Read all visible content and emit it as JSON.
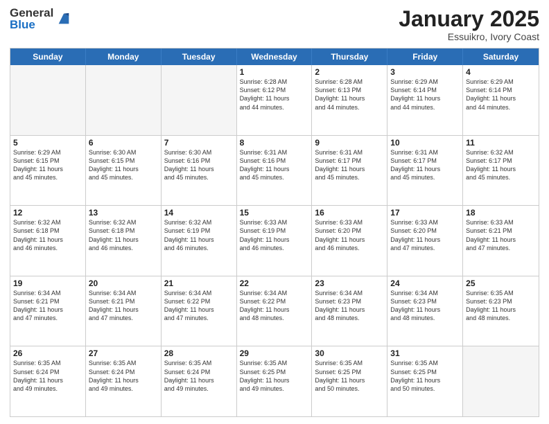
{
  "logo": {
    "general": "General",
    "blue": "Blue"
  },
  "header": {
    "month": "January 2025",
    "location": "Essuikro, Ivory Coast"
  },
  "days_of_week": [
    "Sunday",
    "Monday",
    "Tuesday",
    "Wednesday",
    "Thursday",
    "Friday",
    "Saturday"
  ],
  "weeks": [
    [
      {
        "day": "",
        "info": ""
      },
      {
        "day": "",
        "info": ""
      },
      {
        "day": "",
        "info": ""
      },
      {
        "day": "1",
        "info": "Sunrise: 6:28 AM\nSunset: 6:12 PM\nDaylight: 11 hours\nand 44 minutes."
      },
      {
        "day": "2",
        "info": "Sunrise: 6:28 AM\nSunset: 6:13 PM\nDaylight: 11 hours\nand 44 minutes."
      },
      {
        "day": "3",
        "info": "Sunrise: 6:29 AM\nSunset: 6:14 PM\nDaylight: 11 hours\nand 44 minutes."
      },
      {
        "day": "4",
        "info": "Sunrise: 6:29 AM\nSunset: 6:14 PM\nDaylight: 11 hours\nand 44 minutes."
      }
    ],
    [
      {
        "day": "5",
        "info": "Sunrise: 6:29 AM\nSunset: 6:15 PM\nDaylight: 11 hours\nand 45 minutes."
      },
      {
        "day": "6",
        "info": "Sunrise: 6:30 AM\nSunset: 6:15 PM\nDaylight: 11 hours\nand 45 minutes."
      },
      {
        "day": "7",
        "info": "Sunrise: 6:30 AM\nSunset: 6:16 PM\nDaylight: 11 hours\nand 45 minutes."
      },
      {
        "day": "8",
        "info": "Sunrise: 6:31 AM\nSunset: 6:16 PM\nDaylight: 11 hours\nand 45 minutes."
      },
      {
        "day": "9",
        "info": "Sunrise: 6:31 AM\nSunset: 6:17 PM\nDaylight: 11 hours\nand 45 minutes."
      },
      {
        "day": "10",
        "info": "Sunrise: 6:31 AM\nSunset: 6:17 PM\nDaylight: 11 hours\nand 45 minutes."
      },
      {
        "day": "11",
        "info": "Sunrise: 6:32 AM\nSunset: 6:17 PM\nDaylight: 11 hours\nand 45 minutes."
      }
    ],
    [
      {
        "day": "12",
        "info": "Sunrise: 6:32 AM\nSunset: 6:18 PM\nDaylight: 11 hours\nand 46 minutes."
      },
      {
        "day": "13",
        "info": "Sunrise: 6:32 AM\nSunset: 6:18 PM\nDaylight: 11 hours\nand 46 minutes."
      },
      {
        "day": "14",
        "info": "Sunrise: 6:32 AM\nSunset: 6:19 PM\nDaylight: 11 hours\nand 46 minutes."
      },
      {
        "day": "15",
        "info": "Sunrise: 6:33 AM\nSunset: 6:19 PM\nDaylight: 11 hours\nand 46 minutes."
      },
      {
        "day": "16",
        "info": "Sunrise: 6:33 AM\nSunset: 6:20 PM\nDaylight: 11 hours\nand 46 minutes."
      },
      {
        "day": "17",
        "info": "Sunrise: 6:33 AM\nSunset: 6:20 PM\nDaylight: 11 hours\nand 47 minutes."
      },
      {
        "day": "18",
        "info": "Sunrise: 6:33 AM\nSunset: 6:21 PM\nDaylight: 11 hours\nand 47 minutes."
      }
    ],
    [
      {
        "day": "19",
        "info": "Sunrise: 6:34 AM\nSunset: 6:21 PM\nDaylight: 11 hours\nand 47 minutes."
      },
      {
        "day": "20",
        "info": "Sunrise: 6:34 AM\nSunset: 6:21 PM\nDaylight: 11 hours\nand 47 minutes."
      },
      {
        "day": "21",
        "info": "Sunrise: 6:34 AM\nSunset: 6:22 PM\nDaylight: 11 hours\nand 47 minutes."
      },
      {
        "day": "22",
        "info": "Sunrise: 6:34 AM\nSunset: 6:22 PM\nDaylight: 11 hours\nand 48 minutes."
      },
      {
        "day": "23",
        "info": "Sunrise: 6:34 AM\nSunset: 6:23 PM\nDaylight: 11 hours\nand 48 minutes."
      },
      {
        "day": "24",
        "info": "Sunrise: 6:34 AM\nSunset: 6:23 PM\nDaylight: 11 hours\nand 48 minutes."
      },
      {
        "day": "25",
        "info": "Sunrise: 6:35 AM\nSunset: 6:23 PM\nDaylight: 11 hours\nand 48 minutes."
      }
    ],
    [
      {
        "day": "26",
        "info": "Sunrise: 6:35 AM\nSunset: 6:24 PM\nDaylight: 11 hours\nand 49 minutes."
      },
      {
        "day": "27",
        "info": "Sunrise: 6:35 AM\nSunset: 6:24 PM\nDaylight: 11 hours\nand 49 minutes."
      },
      {
        "day": "28",
        "info": "Sunrise: 6:35 AM\nSunset: 6:24 PM\nDaylight: 11 hours\nand 49 minutes."
      },
      {
        "day": "29",
        "info": "Sunrise: 6:35 AM\nSunset: 6:25 PM\nDaylight: 11 hours\nand 49 minutes."
      },
      {
        "day": "30",
        "info": "Sunrise: 6:35 AM\nSunset: 6:25 PM\nDaylight: 11 hours\nand 50 minutes."
      },
      {
        "day": "31",
        "info": "Sunrise: 6:35 AM\nSunset: 6:25 PM\nDaylight: 11 hours\nand 50 minutes."
      },
      {
        "day": "",
        "info": ""
      }
    ]
  ]
}
